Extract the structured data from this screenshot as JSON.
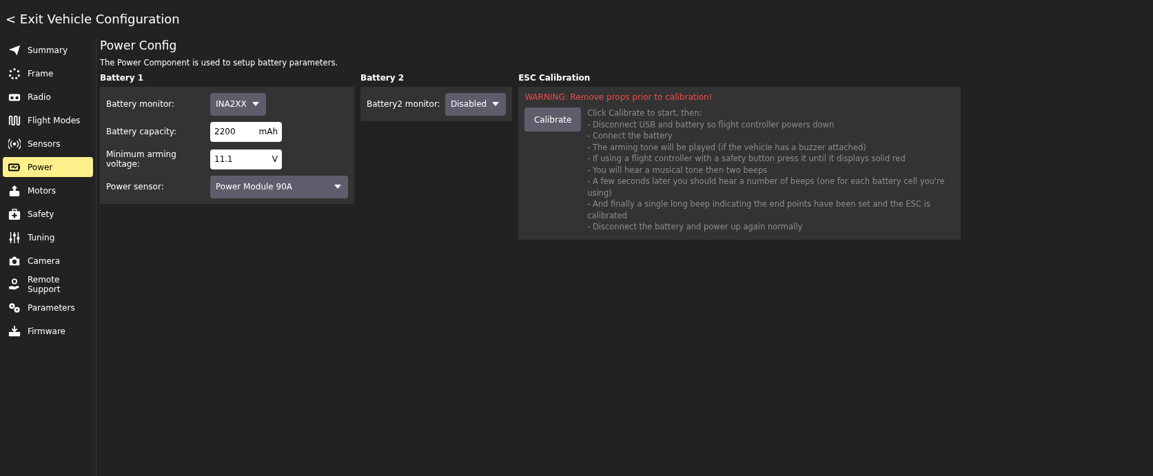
{
  "header": {
    "back_label": "< Exit Vehicle Configuration"
  },
  "sidebar": {
    "items": [
      {
        "label": "Summary",
        "selected": false
      },
      {
        "label": "Frame",
        "selected": false
      },
      {
        "label": "Radio",
        "selected": false
      },
      {
        "label": "Flight Modes",
        "selected": false
      },
      {
        "label": "Sensors",
        "selected": false
      },
      {
        "label": "Power",
        "selected": true
      },
      {
        "label": "Motors",
        "selected": false
      },
      {
        "label": "Safety",
        "selected": false
      },
      {
        "label": "Tuning",
        "selected": false
      },
      {
        "label": "Camera",
        "selected": false
      },
      {
        "label": "Remote Support",
        "selected": false
      },
      {
        "label": "Parameters",
        "selected": false
      },
      {
        "label": "Firmware",
        "selected": false
      }
    ]
  },
  "page": {
    "title": "Power Config",
    "description": "The Power Component is used to setup battery parameters."
  },
  "battery1": {
    "heading": "Battery 1",
    "rows": [
      {
        "kind": "dropdown",
        "label": "Battery monitor:",
        "value": "INA2XX",
        "wide": false
      },
      {
        "kind": "input",
        "label": "Battery capacity:",
        "value": "2200",
        "unit": "mAh"
      },
      {
        "kind": "input",
        "label": "Minimum arming voltage:",
        "value": "11.1",
        "unit": "V"
      },
      {
        "kind": "dropdown",
        "label": "Power sensor:",
        "value": "Power Module 90A",
        "wide": true
      }
    ]
  },
  "battery2": {
    "heading": "Battery 2",
    "rows": [
      {
        "kind": "dropdown",
        "label": "Battery2 monitor:",
        "value": "Disabled",
        "wide": false
      }
    ]
  },
  "esc_calibration": {
    "heading": "ESC Calibration",
    "warning": "WARNING: Remove props prior to calibration!",
    "button": "Calibrate",
    "instructions": [
      "Click Calibrate to start, then:",
      "- Disconnect USB and battery so flight controller powers down",
      "- Connect the battery",
      "- The arming tone will be played (if the vehicle has a buzzer attached)",
      "- If using a flight controller with a safety button press it until it displays solid red",
      "- You will hear a musical tone then two beeps",
      "- A few seconds later you should hear a number of beeps (one for each battery cell you're using)",
      "- And finally a single long beep indicating the end points have been set and the ESC is calibrated",
      "- Disconnect the battery and power up again normally"
    ]
  }
}
